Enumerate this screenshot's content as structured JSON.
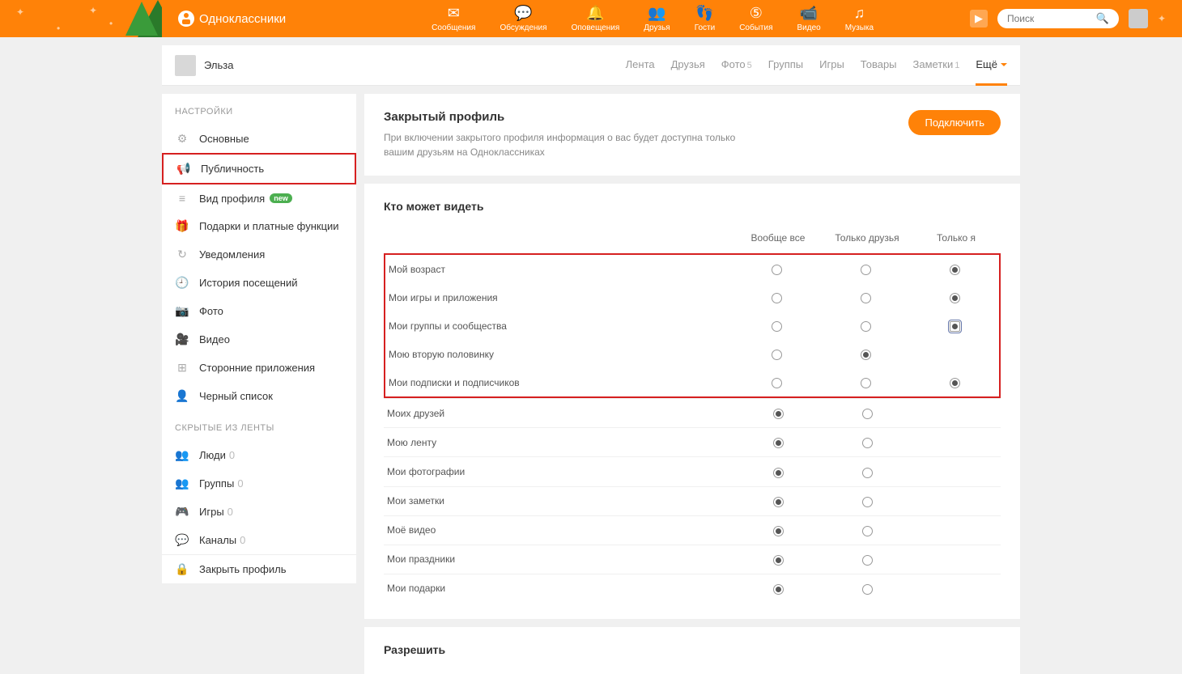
{
  "brand": "Одноклассники",
  "search": {
    "placeholder": "Поиск"
  },
  "topnav": [
    {
      "label": "Сообщения",
      "icon": "✉"
    },
    {
      "label": "Обсуждения",
      "icon": "💬"
    },
    {
      "label": "Оповещения",
      "icon": "🔔"
    },
    {
      "label": "Друзья",
      "icon": "👥"
    },
    {
      "label": "Гости",
      "icon": "👣"
    },
    {
      "label": "События",
      "icon": "⑤"
    },
    {
      "label": "Видео",
      "icon": "📹"
    },
    {
      "label": "Музыка",
      "icon": "♫"
    }
  ],
  "profile": {
    "name": "Эльза",
    "tabs": [
      {
        "label": "Лента",
        "count": ""
      },
      {
        "label": "Друзья",
        "count": ""
      },
      {
        "label": "Фото",
        "count": "5"
      },
      {
        "label": "Группы",
        "count": ""
      },
      {
        "label": "Игры",
        "count": ""
      },
      {
        "label": "Товары",
        "count": ""
      },
      {
        "label": "Заметки",
        "count": "1"
      },
      {
        "label": "Ещё",
        "count": ""
      }
    ]
  },
  "sidebar": {
    "section1_title": "НАСТРОЙКИ",
    "items1": [
      {
        "label": "Основные",
        "icon": "⚙"
      },
      {
        "label": "Публичность",
        "icon": "📢"
      },
      {
        "label": "Вид профиля",
        "icon": "≡",
        "badge": "new"
      },
      {
        "label": "Подарки и платные функции",
        "icon": "🎁"
      },
      {
        "label": "Уведомления",
        "icon": "↻"
      },
      {
        "label": "История посещений",
        "icon": "🕘"
      },
      {
        "label": "Фото",
        "icon": "📷"
      },
      {
        "label": "Видео",
        "icon": "🎥"
      },
      {
        "label": "Сторонние приложения",
        "icon": "⊞"
      },
      {
        "label": "Черный список",
        "icon": "👤"
      }
    ],
    "section2_title": "СКРЫТЫЕ ИЗ ЛЕНТЫ",
    "items2": [
      {
        "label": "Люди",
        "icon": "👥",
        "count": "0"
      },
      {
        "label": "Группы",
        "icon": "👥",
        "count": "0"
      },
      {
        "label": "Игры",
        "icon": "🎮",
        "count": "0"
      },
      {
        "label": "Каналы",
        "icon": "💬",
        "count": "0"
      }
    ],
    "lock_item": {
      "label": "Закрыть профиль",
      "icon": "🔒"
    }
  },
  "closed_profile_panel": {
    "title": "Закрытый профиль",
    "desc": "При включении закрытого профиля информация о вас будет доступна только вашим друзьям на Одноклассниках",
    "button": "Подключить"
  },
  "visibility": {
    "title": "Кто может видеть",
    "columns": [
      "Вообще все",
      "Только друзья",
      "Только я"
    ],
    "rows": [
      {
        "label": "Мой возраст",
        "selected": 2,
        "highlight": true,
        "cols": 3
      },
      {
        "label": "Мои игры и приложения",
        "selected": 2,
        "highlight": true,
        "cols": 3
      },
      {
        "label": "Мои группы и сообщества",
        "selected": 2,
        "highlight": true,
        "cols": 3,
        "boxed": true
      },
      {
        "label": "Мою вторую половинку",
        "selected": 1,
        "highlight": true,
        "cols": 2
      },
      {
        "label": "Мои подписки и подписчиков",
        "selected": 2,
        "highlight": true,
        "cols": 3
      },
      {
        "label": "Моих друзей",
        "selected": 0,
        "cols": 2
      },
      {
        "label": "Мою ленту",
        "selected": 0,
        "cols": 2
      },
      {
        "label": "Мои фотографии",
        "selected": 0,
        "cols": 2
      },
      {
        "label": "Мои заметки",
        "selected": 0,
        "cols": 2
      },
      {
        "label": "Моё видео",
        "selected": 0,
        "cols": 2
      },
      {
        "label": "Мои праздники",
        "selected": 0,
        "cols": 2
      },
      {
        "label": "Мои подарки",
        "selected": 0,
        "cols": 2
      }
    ]
  },
  "allow": {
    "title": "Разрешить"
  }
}
